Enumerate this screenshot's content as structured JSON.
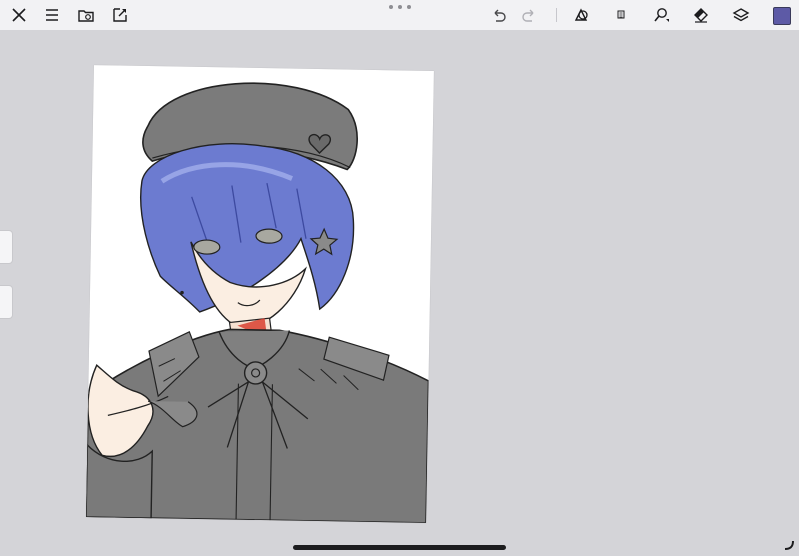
{
  "toolbar": {
    "left_tools": [
      "close-icon",
      "menu-icon",
      "gallery-icon",
      "canvas-settings-icon"
    ],
    "center": "more-options-icon",
    "right_tools": [
      "undo-icon",
      "redo-icon",
      "selection-icon",
      "transform-icon",
      "brush-icon",
      "eraser-icon",
      "layers-icon"
    ],
    "current_color": "#5d5aa6"
  },
  "canvas": {
    "artwork": "anime-character-illustration"
  },
  "colors": {
    "background": "#d4d4d8",
    "toolbar": "#f2f2f4",
    "hair": "#6c7bd0",
    "clothes": "#7a7a7a",
    "skin": "#fbeee2"
  }
}
